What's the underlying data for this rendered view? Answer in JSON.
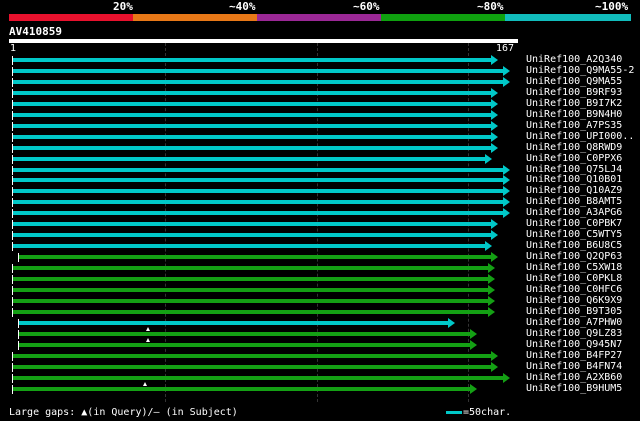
{
  "scale": {
    "labels": [
      "20%",
      "~40%",
      "~60%",
      "~80%",
      "~100%"
    ],
    "colors": [
      "#e8112d",
      "#e87817",
      "#9b2896",
      "#0fa10f",
      "#11bcbc"
    ]
  },
  "query": {
    "title": "AV410859",
    "start_label": "1",
    "end_label": "167"
  },
  "hits": [
    {
      "name": "UniRef100_A2Q340",
      "start": 1,
      "end": 158,
      "color": "#00c8c8"
    },
    {
      "name": "UniRef100_Q9MA55-2",
      "start": 1,
      "end": 162,
      "color": "#00c8c8"
    },
    {
      "name": "UniRef100_Q9MA55",
      "start": 1,
      "end": 162,
      "color": "#00c8c8"
    },
    {
      "name": "UniRef100_B9RF93",
      "start": 1,
      "end": 158,
      "color": "#00c8c8"
    },
    {
      "name": "UniRef100_B9I7K2",
      "start": 1,
      "end": 158,
      "color": "#00c8c8"
    },
    {
      "name": "UniRef100_B9N4H0",
      "start": 1,
      "end": 158,
      "color": "#00c8c8"
    },
    {
      "name": "UniRef100_A7PS35",
      "start": 1,
      "end": 158,
      "color": "#00c8c8"
    },
    {
      "name": "UniRef100_UPI000..",
      "start": 1,
      "end": 158,
      "color": "#00c8c8"
    },
    {
      "name": "UniRef100_Q8RWD9",
      "start": 1,
      "end": 158,
      "color": "#00c8c8"
    },
    {
      "name": "UniRef100_C0PPX6",
      "start": 1,
      "end": 156,
      "color": "#00c8c8"
    },
    {
      "name": "UniRef100_Q75LJ4",
      "start": 1,
      "end": 162,
      "color": "#00c8c8"
    },
    {
      "name": "UniRef100_Q10B01",
      "start": 1,
      "end": 162,
      "color": "#00c8c8"
    },
    {
      "name": "UniRef100_Q10AZ9",
      "start": 1,
      "end": 162,
      "color": "#00c8c8"
    },
    {
      "name": "UniRef100_B8AMT5",
      "start": 1,
      "end": 162,
      "color": "#00c8c8"
    },
    {
      "name": "UniRef100_A3APG6",
      "start": 1,
      "end": 162,
      "color": "#00c8c8"
    },
    {
      "name": "UniRef100_C0PBK7",
      "start": 1,
      "end": 158,
      "color": "#00c8c8"
    },
    {
      "name": "UniRef100_C5WTY5",
      "start": 1,
      "end": 158,
      "color": "#00c8c8"
    },
    {
      "name": "UniRef100_B6U8C5",
      "start": 1,
      "end": 156,
      "color": "#00c8c8"
    },
    {
      "name": "UniRef100_Q2QP63",
      "start": 3,
      "end": 158,
      "color": "#14a014"
    },
    {
      "name": "UniRef100_C5XW18",
      "start": 1,
      "end": 157,
      "color": "#14a014"
    },
    {
      "name": "UniRef100_C0PKL8",
      "start": 1,
      "end": 157,
      "color": "#14a014"
    },
    {
      "name": "UniRef100_C0HFC6",
      "start": 1,
      "end": 157,
      "color": "#14a014"
    },
    {
      "name": "UniRef100_Q6K9X9",
      "start": 1,
      "end": 157,
      "color": "#14a014"
    },
    {
      "name": "UniRef100_B9T305",
      "start": 1,
      "end": 157,
      "color": "#14a014"
    },
    {
      "name": "UniRef100_A7PHW0",
      "start": 3,
      "end": 144,
      "color": "#00c8c8"
    },
    {
      "name": "UniRef100_Q9LZ83",
      "start": 3,
      "end": 151,
      "color": "#14a014",
      "gap": 28
    },
    {
      "name": "UniRef100_Q945N7",
      "start": 3,
      "end": 151,
      "color": "#14a014",
      "gap": 28
    },
    {
      "name": "UniRef100_B4FP27",
      "start": 1,
      "end": 158,
      "color": "#14a014"
    },
    {
      "name": "UniRef100_B4FN74",
      "start": 1,
      "end": 158,
      "color": "#14a014"
    },
    {
      "name": "UniRef100_A2XB60",
      "start": 1,
      "end": 162,
      "color": "#14a014"
    },
    {
      "name": "UniRef100_B9HUM5",
      "start": 1,
      "end": 151,
      "color": "#14a014",
      "gap": 27
    }
  ],
  "footer": {
    "gaps_label": "Large gaps:",
    "gaps_query": "(in Query)/",
    "gaps_dash": "–",
    "gaps_subject": " (in Subject)",
    "scale_text": "=50char."
  }
}
